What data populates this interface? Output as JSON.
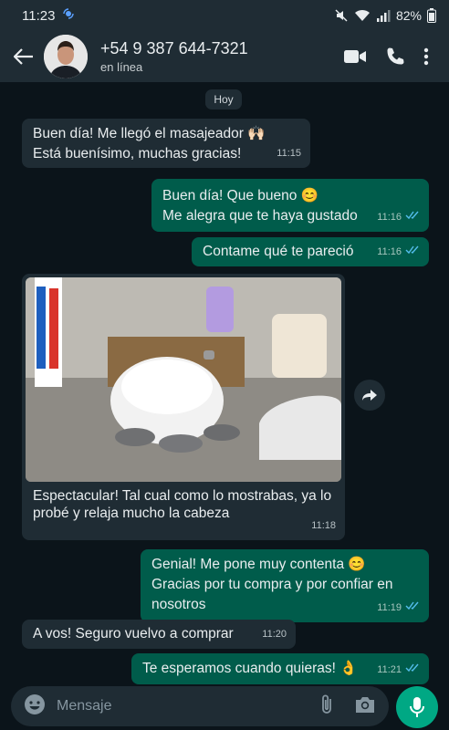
{
  "status": {
    "time": "11:23",
    "battery": "82%"
  },
  "header": {
    "name": "+54 9 387 644-7321",
    "presence": "en línea"
  },
  "chat": {
    "date_chip": "Hoy",
    "messages": [
      {
        "dir": "in",
        "lines": [
          "Buen día! Me llegó el masajeador 🙌🏻",
          "Está buenísimo, muchas gracias!"
        ],
        "time": "11:15"
      },
      {
        "dir": "out",
        "lines": [
          "Buen día! Que bueno 😊",
          "Me alegra que te haya gustado"
        ],
        "time": "11:16"
      },
      {
        "dir": "out",
        "lines": [
          "Contame qué te pareció"
        ],
        "time": "11:16"
      },
      {
        "dir": "in",
        "caption": "Espectacular! Tal cual como lo mostrabas, ya lo probé y relaja mucho la cabeza",
        "time": "11:18"
      },
      {
        "dir": "out",
        "lines": [
          "Genial! Me pone muy contenta 😊",
          "Gracias por tu compra y por confiar en nosotros"
        ],
        "time": "11:19"
      },
      {
        "dir": "in",
        "lines": [
          "A vos! Seguro vuelvo a comprar"
        ],
        "time": "11:20"
      },
      {
        "dir": "out",
        "lines": [
          "Te esperamos cuando quieras! 👌"
        ],
        "time": "11:21"
      }
    ]
  },
  "composer": {
    "placeholder": "Mensaje"
  },
  "colors": {
    "bg": "#0b141a",
    "bubble_in": "#1f2c34",
    "bubble_out": "#005c4b",
    "accent": "#00a884",
    "read_ticks": "#53bdeb"
  }
}
